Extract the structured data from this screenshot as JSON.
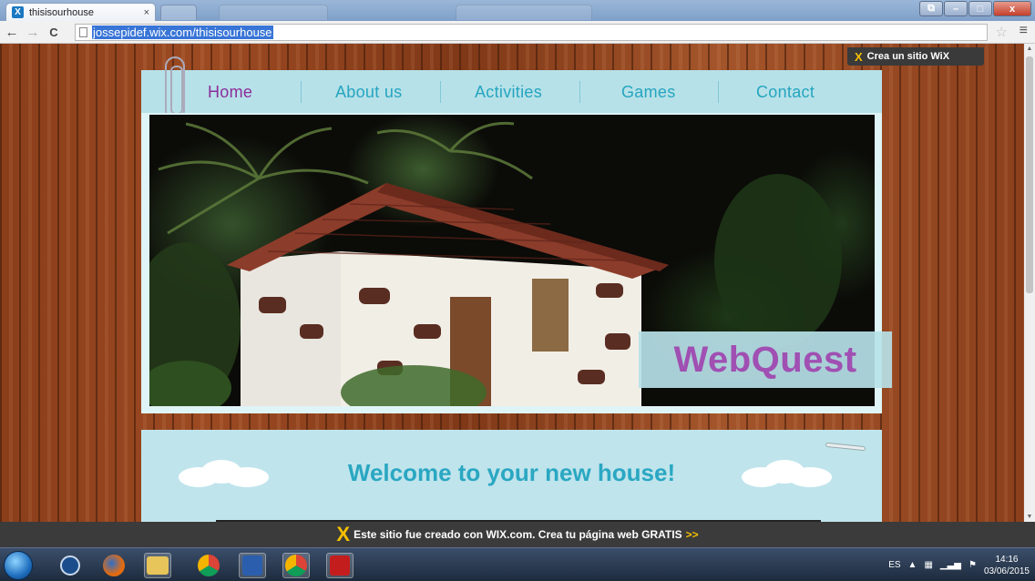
{
  "browser": {
    "tab_title": "thisisourhouse",
    "tab_close": "×",
    "favicon": "X",
    "url": "jossepidef.wix.com/thisisourhouse",
    "back_glyph": "←",
    "forward_glyph": "→",
    "reload_glyph": "C",
    "star_glyph": "☆",
    "menu_glyph": "≡",
    "minimize_glyph": "–",
    "maximize_glyph": "□",
    "close_glyph": "x",
    "restore_glyph": "⧉"
  },
  "wix_badge": {
    "icon": "X",
    "label": "Crea un sitio WiX"
  },
  "nav": {
    "items": [
      {
        "label": "Home"
      },
      {
        "label": "About us"
      },
      {
        "label": "Activities"
      },
      {
        "label": "Games"
      },
      {
        "label": "Contact"
      }
    ],
    "active": "Home"
  },
  "hero": {
    "label": "WebQuest"
  },
  "welcome": {
    "text": "Welcome to your new house!"
  },
  "wix_footer": {
    "text": "Este sitio fue creado con WIX.com. Crea tu página web GRATIS",
    "arrows": ">>",
    "icon": "X"
  },
  "taskbar": {
    "language": "ES",
    "time": "14:16",
    "date": "03/06/2015"
  },
  "colors": {
    "nav_bg": "#b7e1e8",
    "nav_text": "#25a5c0",
    "nav_active": "#8a2d9b",
    "webquest": "#a04fb2",
    "welcome_text": "#2aa7c2",
    "wix_yellow": "#f6c000"
  }
}
